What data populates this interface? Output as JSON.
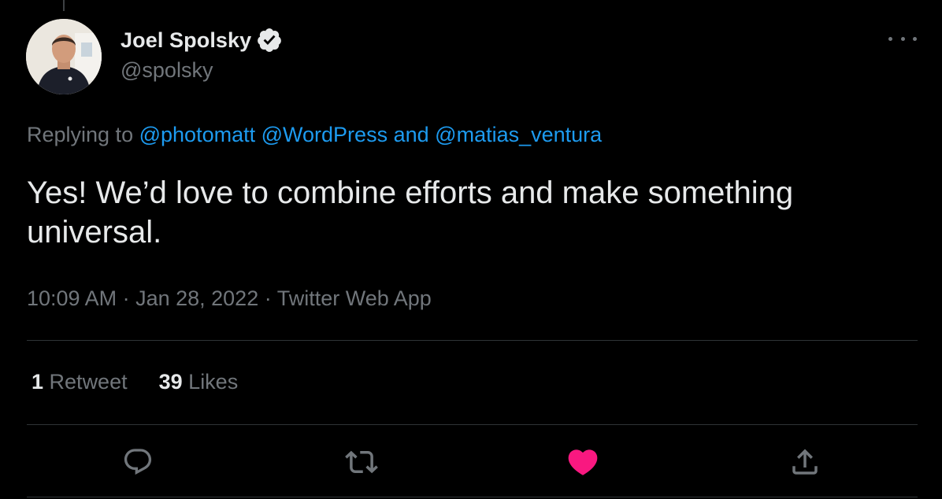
{
  "tweet": {
    "author": {
      "display_name": "Joel Spolsky",
      "handle": "@spolsky",
      "verified": true,
      "avatar": "profile-photo"
    },
    "replying_to": {
      "prefix": "Replying to",
      "mention_1": "@photomatt",
      "mention_2": "@WordPress",
      "conjunction": "and",
      "mention_3": "@matias_ventura"
    },
    "text": "Yes! We’d love to combine efforts and make something universal.",
    "timestamp": "10:09 AM · Jan 28, 2022 · Twitter Web App",
    "stats": {
      "retweets_count": "1",
      "retweets_label": "Retweet",
      "likes_count": "39",
      "likes_label": "Likes"
    },
    "actions": {
      "reply_icon": "comment-icon",
      "retweet_icon": "retweet-icon",
      "like_icon": "heart-filled-icon",
      "share_icon": "share-icon"
    }
  },
  "colors": {
    "background": "#000000",
    "text_primary": "#e7e9ea",
    "text_secondary": "#71767b",
    "link": "#1d9bf0",
    "like": "#f91880",
    "divider": "#2f3336"
  }
}
